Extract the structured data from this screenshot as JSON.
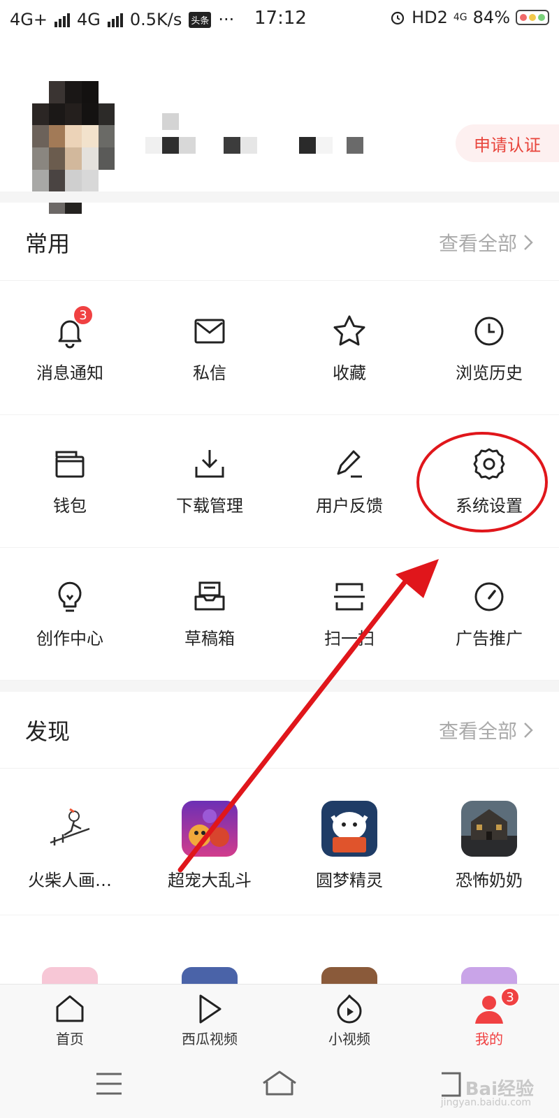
{
  "status_bar": {
    "net1": "4G+",
    "net2": "4G",
    "speed": "0.5K/s",
    "app_tag": "头条",
    "more": "···",
    "time": "17:12",
    "hd": "HD2",
    "lte": "4G",
    "battery": "84%"
  },
  "profile": {
    "apply_label": "申请认证"
  },
  "common": {
    "title": "常用",
    "more": "查看全部",
    "rows": [
      [
        {
          "label": "消息通知",
          "icon": "bell-icon",
          "badge": "3"
        },
        {
          "label": "私信",
          "icon": "mail-icon"
        },
        {
          "label": "收藏",
          "icon": "star-icon"
        },
        {
          "label": "浏览历史",
          "icon": "clock-icon"
        }
      ],
      [
        {
          "label": "钱包",
          "icon": "wallet-icon"
        },
        {
          "label": "下载管理",
          "icon": "download-icon"
        },
        {
          "label": "用户反馈",
          "icon": "pencil-icon"
        },
        {
          "label": "系统设置",
          "icon": "gear-icon"
        }
      ],
      [
        {
          "label": "创作中心",
          "icon": "lightbulb-icon"
        },
        {
          "label": "草稿箱",
          "icon": "draft-box-icon"
        },
        {
          "label": "扫一扫",
          "icon": "scan-icon"
        },
        {
          "label": "广告推广",
          "icon": "gauge-icon"
        }
      ]
    ]
  },
  "discover": {
    "title": "发现",
    "more": "查看全部",
    "items": [
      {
        "label": "火柴人画…",
        "icon": "stickman-game-icon"
      },
      {
        "label": "超宠大乱斗",
        "icon": "pet-battle-game-icon"
      },
      {
        "label": "圆梦精灵",
        "icon": "dream-sprite-icon"
      },
      {
        "label": "恐怖奶奶",
        "icon": "horror-granny-icon"
      }
    ]
  },
  "tabbar": {
    "tabs": [
      {
        "label": "首页",
        "icon": "home-icon"
      },
      {
        "label": "西瓜视频",
        "icon": "play-icon"
      },
      {
        "label": "小视频",
        "icon": "short-video-icon"
      },
      {
        "label": "我的",
        "icon": "user-icon",
        "badge": "3",
        "active": true
      }
    ]
  },
  "watermark": {
    "text": "Bai经验",
    "sub": "jingyan.baidu.com"
  },
  "colors": {
    "accent": "#f04142",
    "annotation": "#e0161b"
  }
}
